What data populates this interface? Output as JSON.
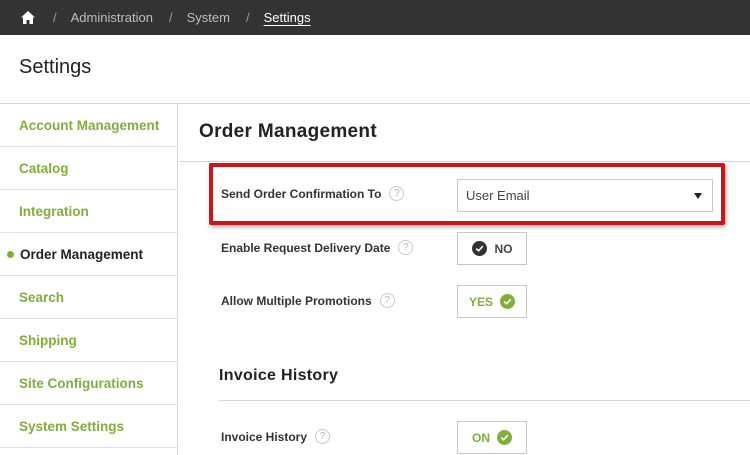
{
  "breadcrumb": {
    "home_icon": "home-icon",
    "separator": "/",
    "items": [
      "Administration",
      "System",
      "Settings"
    ]
  },
  "page": {
    "title": "Settings"
  },
  "sidebar": {
    "items": [
      {
        "label": "Account Management",
        "active": false
      },
      {
        "label": "Catalog",
        "active": false
      },
      {
        "label": "Integration",
        "active": false
      },
      {
        "label": "Order Management",
        "active": true
      },
      {
        "label": "Search",
        "active": false
      },
      {
        "label": "Shipping",
        "active": false
      },
      {
        "label": "Site Configurations",
        "active": false
      },
      {
        "label": "System Settings",
        "active": false
      }
    ]
  },
  "main": {
    "title": "Order Management",
    "help_glyph": "?",
    "send_confirmation": {
      "label": "Send Order Confirmation To",
      "value": "User Email"
    },
    "request_delivery_date": {
      "label": "Enable Request Delivery Date",
      "state": "NO"
    },
    "multiple_promotions": {
      "label": "Allow Multiple Promotions",
      "state": "YES"
    },
    "invoice_section": {
      "title": "Invoice History",
      "invoice_history": {
        "label": "Invoice History",
        "state": "ON"
      }
    }
  },
  "colors": {
    "accent_green": "#7fae3b",
    "topbar_bg": "#333333",
    "highlight_red": "#c8171c"
  }
}
